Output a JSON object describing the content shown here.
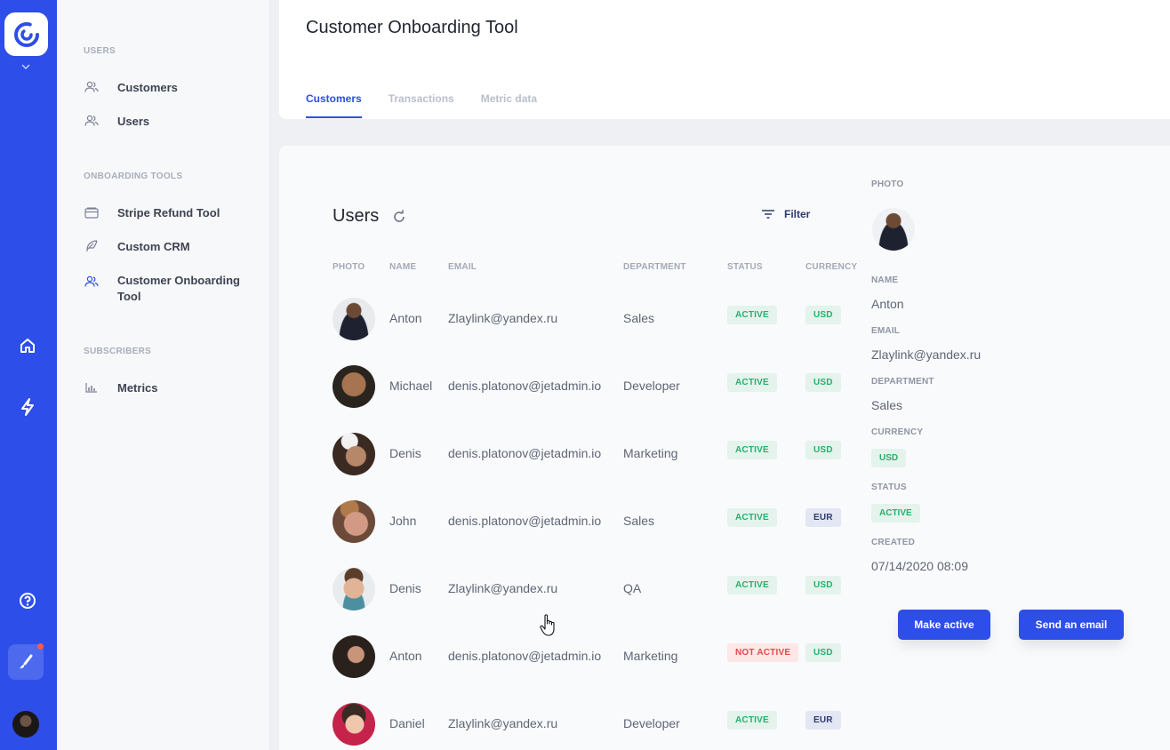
{
  "colors": {
    "primary": "#2d4ee8",
    "active": "#25b06e",
    "not_active": "#e04c4c"
  },
  "rail": {
    "icons": [
      "logo-icon",
      "chevron-down-icon",
      "home-icon",
      "bolt-icon",
      "help-icon",
      "brush-icon",
      "avatar"
    ]
  },
  "sidebar": {
    "sections": [
      {
        "title": "USERS",
        "items": [
          {
            "label": "Customers",
            "icon": "users-icon"
          },
          {
            "label": "Users",
            "icon": "users-icon"
          }
        ]
      },
      {
        "title": "ONBOARDING TOOLS",
        "items": [
          {
            "label": "Stripe Refund Tool",
            "icon": "card-icon"
          },
          {
            "label": "Custom CRM",
            "icon": "feather-icon"
          },
          {
            "label": "Customer Onboarding Tool",
            "icon": "users-icon"
          }
        ]
      },
      {
        "title": "SUBSCRIBERS",
        "items": [
          {
            "label": "Metrics",
            "icon": "bar-chart-icon"
          }
        ]
      }
    ]
  },
  "header": {
    "title": "Customer Onboarding Tool",
    "tabs": [
      {
        "label": "Customers",
        "active": true
      },
      {
        "label": "Transactions",
        "active": false
      },
      {
        "label": "Metric data",
        "active": false
      }
    ]
  },
  "users_table": {
    "title": "Users",
    "filter_label": "Filter",
    "columns": [
      "PHOTO",
      "NAME",
      "EMAIL",
      "DEPARTMENT",
      "STATUS",
      "CURRENCY"
    ],
    "rows": [
      {
        "name": "Anton",
        "email": "Zlaylink@yandex.ru",
        "department": "Sales",
        "status": "ACTIVE",
        "currency": "USD"
      },
      {
        "name": "Michael",
        "email": "denis.platonov@jetadmin.io",
        "department": "Developer",
        "status": "ACTIVE",
        "currency": "USD"
      },
      {
        "name": "Denis",
        "email": "denis.platonov@jetadmin.io",
        "department": "Marketing",
        "status": "ACTIVE",
        "currency": "USD"
      },
      {
        "name": "John",
        "email": "denis.platonov@jetadmin.io",
        "department": "Sales",
        "status": "ACTIVE",
        "currency": "EUR"
      },
      {
        "name": "Denis",
        "email": "Zlaylink@yandex.ru",
        "department": "QA",
        "status": "ACTIVE",
        "currency": "USD"
      },
      {
        "name": "Anton",
        "email": "denis.platonov@jetadmin.io",
        "department": "Marketing",
        "status": "NOT ACTIVE",
        "currency": "USD"
      },
      {
        "name": "Daniel",
        "email": "Zlaylink@yandex.ru",
        "department": "Developer",
        "status": "ACTIVE",
        "currency": "EUR"
      }
    ]
  },
  "detail": {
    "photo_label": "PHOTO",
    "name_label": "NAME",
    "name": "Anton",
    "email_label": "EMAIL",
    "email": "Zlaylink@yandex.ru",
    "department_label": "DEPARTMENT",
    "department": "Sales",
    "currency_label": "CURRENCY",
    "currency": "USD",
    "status_label": "STATUS",
    "status": "ACTIVE",
    "created_label": "CREATED",
    "created": "07/14/2020 08:09",
    "make_active_label": "Make active",
    "send_email_label": "Send an email"
  }
}
